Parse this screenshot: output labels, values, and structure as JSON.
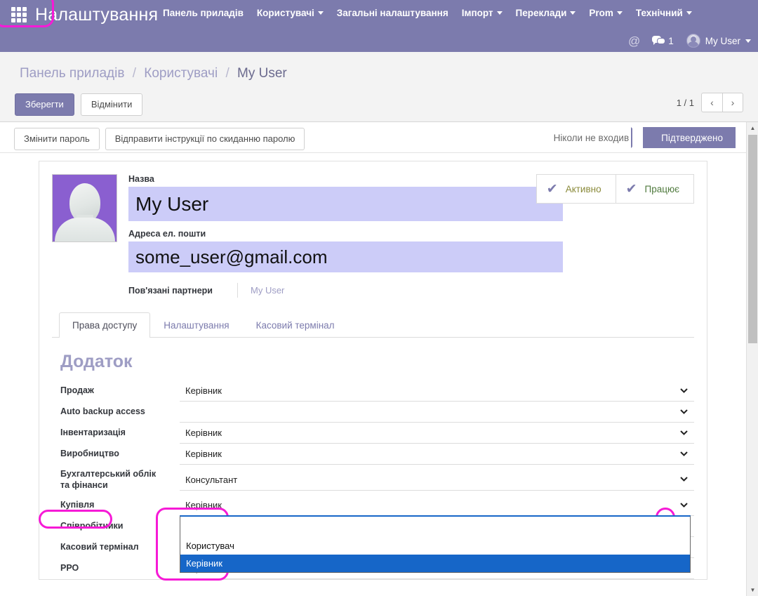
{
  "navbar": {
    "apps_icon": "apps-grid-icon",
    "brand": "Налаштування",
    "menu": [
      {
        "label": "Панель приладів",
        "has_caret": false
      },
      {
        "label": "Користувачі",
        "has_caret": true
      },
      {
        "label": "Загальні налаштування",
        "has_caret": false
      },
      {
        "label": "Імпорт",
        "has_caret": true
      },
      {
        "label": "Переклади",
        "has_caret": true
      },
      {
        "label": "Prom",
        "has_caret": true
      },
      {
        "label": "Технічний",
        "has_caret": true
      }
    ],
    "mention_icon": "@",
    "messages_count": "1",
    "user_name": "My User"
  },
  "control_panel": {
    "breadcrumb": {
      "item1": "Панель приладів",
      "sep1": "/",
      "item2": "Користувачі",
      "sep2": "/",
      "current": "My User"
    },
    "save_label": "Зберегти",
    "discard_label": "Відмінити",
    "pager_label": "1 / 1",
    "prev_icon": "‹",
    "next_icon": "›"
  },
  "statusbar": {
    "change_password": "Змінити пароль",
    "send_reset": "Відправити інструкції по скиданню паролю",
    "stage_inactive": "Ніколи не входив",
    "stage_active": "Підтверджено"
  },
  "form": {
    "avatar": "user-avatar-placeholder",
    "name_label": "Назва",
    "name_value": "My User",
    "email_label": "Адреса ел. пошти",
    "email_value": "some_user@gmail.com",
    "partners_label": "Пов'язані партнери",
    "partners_value": "My User",
    "checkboxes": [
      {
        "label": "Активно",
        "checked": true
      },
      {
        "label": "Працює",
        "checked": true
      }
    ]
  },
  "notebook": {
    "tabs": [
      {
        "label": "Права доступу",
        "active": true
      },
      {
        "label": "Налаштування",
        "active": false
      },
      {
        "label": "Касовий термінал",
        "active": false
      }
    ]
  },
  "access_rights": {
    "group_title": "Додаток",
    "rows": [
      {
        "label": "Продаж",
        "value": "Керівник"
      },
      {
        "label": "Auto backup access",
        "value": ""
      },
      {
        "label": "Інвентаризація",
        "value": "Керівник"
      },
      {
        "label": "Виробництво",
        "value": "Керівник"
      },
      {
        "label": "Бухгалтерський облік та фінанси",
        "value": "Консультант"
      },
      {
        "label": "Купівля",
        "value": "Керівник"
      },
      {
        "label": "Співробітники",
        "value": ""
      },
      {
        "label": "Касовий термінал",
        "value": ""
      },
      {
        "label": "РРО",
        "value": "Керівник"
      }
    ],
    "open_dropdown": {
      "row_index": 5,
      "options": [
        {
          "label": "",
          "selected": false
        },
        {
          "label": "Користувач",
          "selected": false
        },
        {
          "label": "Керівник",
          "selected": true
        }
      ]
    }
  },
  "highlights": {
    "color": "#f61ad6",
    "targets": [
      "save-button",
      "kupivlya-label",
      "open-dropdown",
      "dropdown-chevron"
    ]
  },
  "scrollbar": {
    "up_icon": "▲",
    "down_icon": "▼"
  }
}
